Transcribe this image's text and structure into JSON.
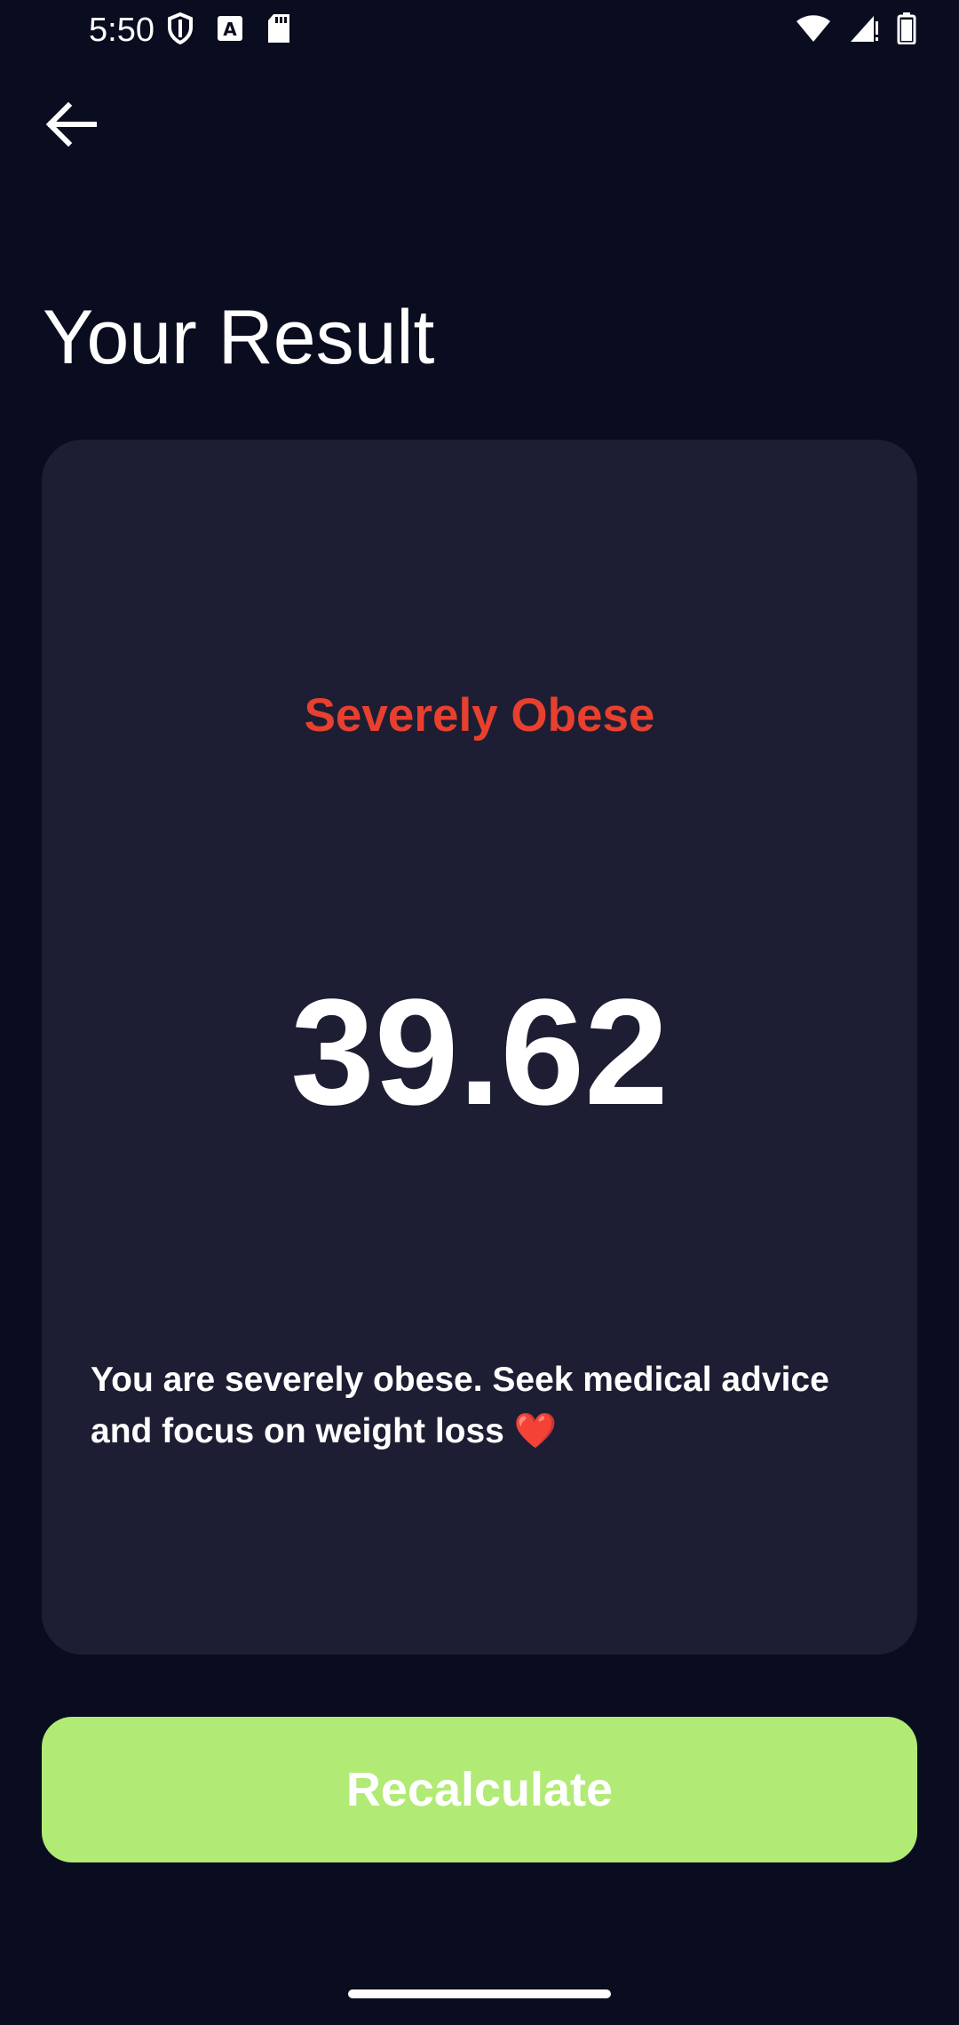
{
  "status_bar": {
    "time": "5:50",
    "left_icons": [
      "shield-icon",
      "text-a-icon",
      "sd-card-icon"
    ],
    "right_icons": [
      "wifi-icon",
      "cell-signal-icon",
      "battery-icon"
    ]
  },
  "header": {
    "back_icon": "arrow-left-icon",
    "title": "Your Result"
  },
  "result": {
    "category": "Severely Obese",
    "bmi": "39.62",
    "advice": "You are severely obese. Seek medical advice and focus on weight loss ❤️"
  },
  "actions": {
    "recalculate_label": "Recalculate"
  },
  "colors": {
    "background": "#0a0c1f",
    "card": "#1d1e33",
    "category_red": "#e8402f",
    "button_green": "#b1ea74"
  }
}
